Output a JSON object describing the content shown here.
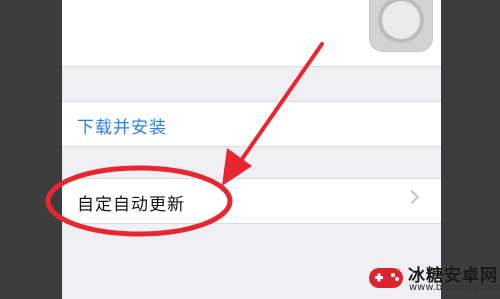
{
  "settings": {
    "download_install_label": "下载并安装",
    "custom_auto_update_label": "自定自动更新"
  },
  "colors": {
    "accent_link": "#2b7df0",
    "annotation_red": "#e8262f",
    "background_group": "#efeff4"
  },
  "watermark": {
    "title": "冰糖安卓网",
    "url": "www.btxtdmy.com"
  },
  "icons": {
    "assistive_touch": "assistive-touch-icon",
    "chevron": "chevron-right-icon",
    "watermark_logo": "game-controller-icon"
  }
}
